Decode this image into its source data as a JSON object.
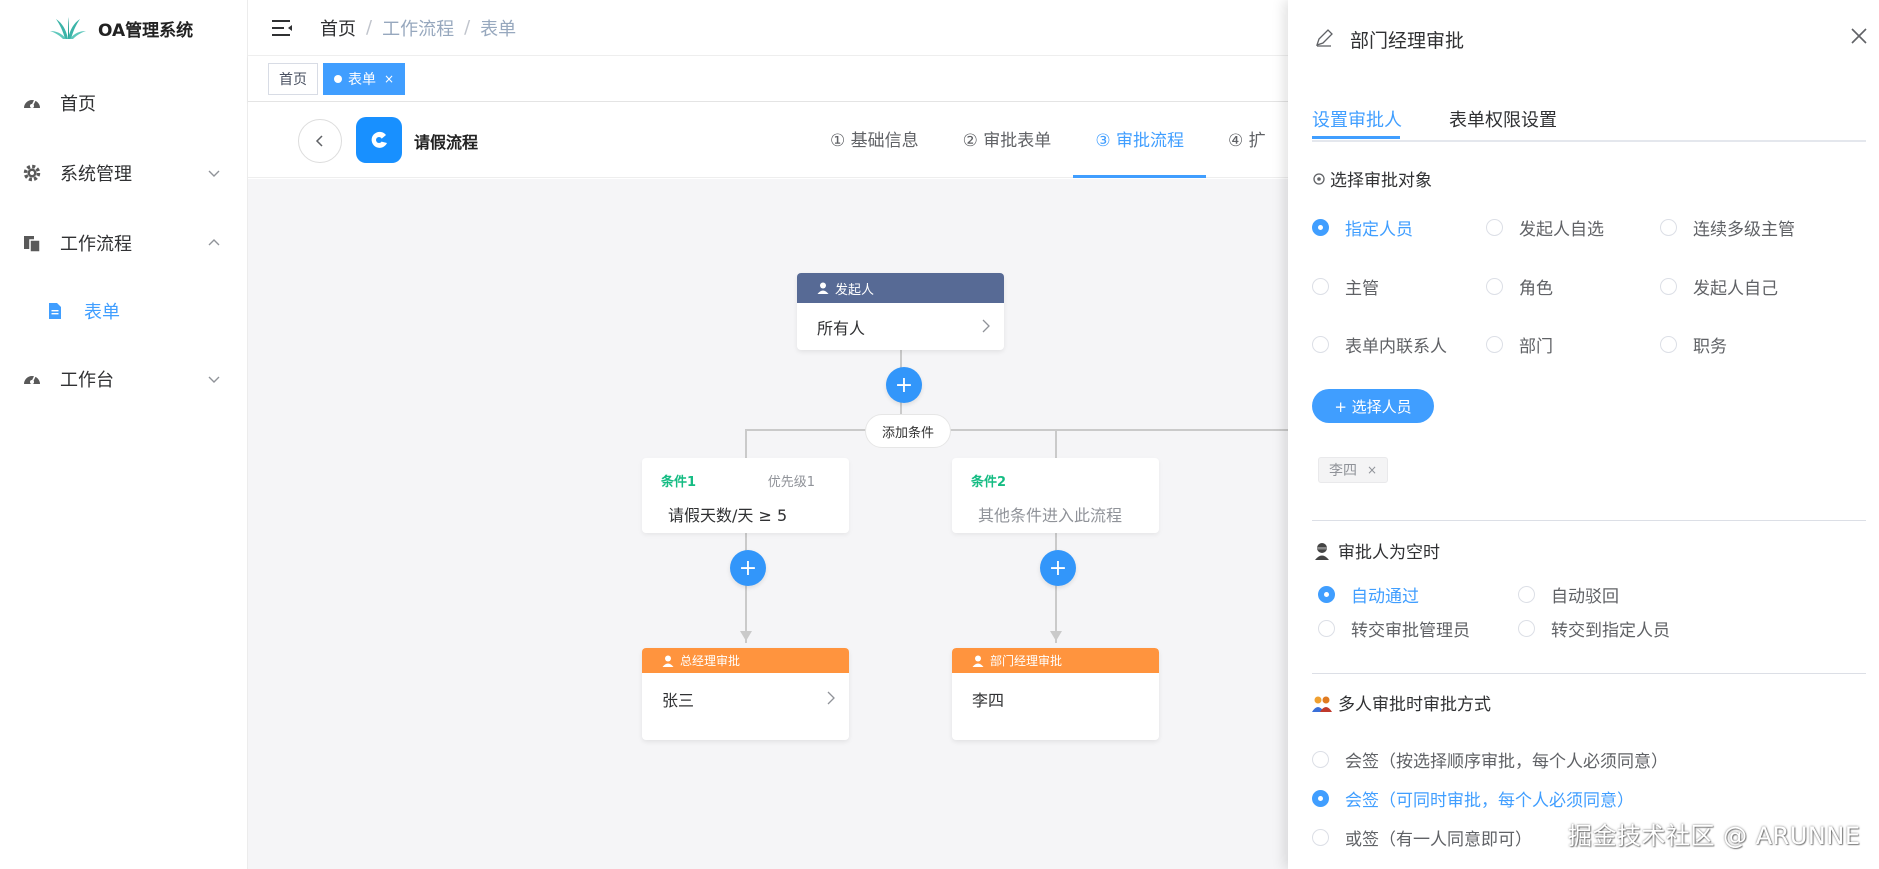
{
  "app": {
    "name": "OA管理系统"
  },
  "sidebar": {
    "items": [
      {
        "label": "首页",
        "icon": "dashboard-icon"
      },
      {
        "label": "系统管理",
        "icon": "gear-icon"
      },
      {
        "label": "工作流程",
        "icon": "copy-icon"
      },
      {
        "label": "表单",
        "icon": "document-icon"
      },
      {
        "label": "工作台",
        "icon": "dashboard-icon"
      }
    ]
  },
  "breadcrumb": [
    "首页",
    "工作流程",
    "表单"
  ],
  "tags": [
    {
      "label": "首页",
      "close": ""
    },
    {
      "label": "表单",
      "close": "×"
    }
  ],
  "designer": {
    "title": "请假流程",
    "steps": [
      "① 基础信息",
      "② 审批表单",
      "③ 审批流程",
      "④ 扩"
    ]
  },
  "flow": {
    "start": {
      "head": "发起人",
      "body": "所有人"
    },
    "add_condition": "添加条件",
    "plus": "+",
    "conditions": [
      {
        "name": "条件1",
        "priority": "优先级1",
        "text": "请假天数/天 ≥ 5"
      },
      {
        "name": "条件2",
        "priority": "",
        "text": "其他条件进入此流程"
      }
    ],
    "approvers": [
      {
        "head": "总经理审批",
        "body": "张三"
      },
      {
        "head": "部门经理审批",
        "body": "李四"
      }
    ]
  },
  "drawer": {
    "title": "部门经理审批",
    "tabs": [
      "设置审批人",
      "表单权限设置"
    ],
    "section1": "选择审批对象",
    "approver_types": [
      {
        "label": "指定人员",
        "checked": true
      },
      {
        "label": "发起人自选",
        "checked": false
      },
      {
        "label": "连续多级主管",
        "checked": false
      },
      {
        "label": "主管",
        "checked": false
      },
      {
        "label": "角色",
        "checked": false
      },
      {
        "label": "发起人自己",
        "checked": false
      },
      {
        "label": "表单内联系人",
        "checked": false
      },
      {
        "label": "部门",
        "checked": false
      },
      {
        "label": "职务",
        "checked": false
      }
    ],
    "select_button": "+ 选择人员",
    "selected": {
      "label": "李四",
      "close": "×"
    },
    "section2": "审批人为空时",
    "empty_options": [
      {
        "label": "自动通过",
        "checked": true
      },
      {
        "label": "自动驳回",
        "checked": false
      },
      {
        "label": "转交审批管理员",
        "checked": false
      },
      {
        "label": "转交到指定人员",
        "checked": false
      }
    ],
    "section3": "多人审批时审批方式",
    "multi_options": [
      {
        "label": "会签（按选择顺序审批，每个人必须同意）",
        "checked": false
      },
      {
        "label": "会签（可同时审批，每个人必须同意）",
        "checked": true
      },
      {
        "label": "或签（有一人同意即可）",
        "checked": false
      }
    ]
  },
  "watermark": "掘金技术社区 @ ARUNNE",
  "colors": {
    "primary": "#409eff",
    "start_head": "#576a95",
    "approver_head": "#ff943e",
    "condition_name": "#15bc83",
    "canvas_bg": "#f5f5f7"
  }
}
